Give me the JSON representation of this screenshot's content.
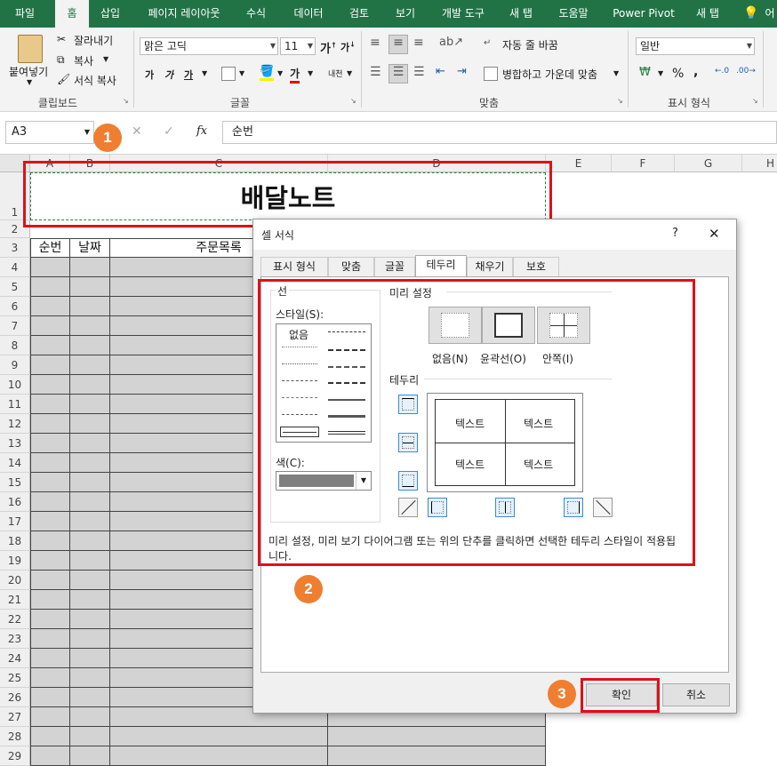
{
  "ribbon_tabs": [
    "파일",
    "홈",
    "삽입",
    "페이지 레이아웃",
    "수식",
    "데이터",
    "검토",
    "보기",
    "개발 도구",
    "새 탭",
    "도움말",
    "Power Pivot",
    "새 탭",
    "어"
  ],
  "clipboard": {
    "paste": "붙여넣기",
    "cut": "잘라내기",
    "copy": "복사",
    "format_painter": "서식 복사",
    "group": "클립보드"
  },
  "font": {
    "name": "맑은 고딕",
    "size": "11",
    "group": "글꼴",
    "bold": "가",
    "italic": "가",
    "underline": "가",
    "grow": "가",
    "shrink": "가",
    "font_color": "가",
    "phonetic": "내천"
  },
  "alignment": {
    "wrap": "자동 줄 바꿈",
    "merge": "병합하고 가운데 맞춤",
    "group": "맞춤"
  },
  "number": {
    "format": "일반",
    "percent": "%",
    "comma": ",",
    "group": "표시 형식"
  },
  "formula_bar": {
    "name_box": "A3",
    "content": "순번",
    "fx": "fx"
  },
  "columns": [
    "A",
    "B",
    "C",
    "D",
    "E",
    "F",
    "G",
    "H"
  ],
  "rows": [
    "1",
    "2",
    "3",
    "4",
    "5",
    "6",
    "7",
    "8",
    "9",
    "10",
    "11",
    "12",
    "13",
    "14",
    "15",
    "16",
    "17",
    "18",
    "19",
    "20",
    "21",
    "22",
    "23",
    "24",
    "25",
    "26",
    "27",
    "28",
    "29"
  ],
  "sheet": {
    "title": "배달노트",
    "headers": [
      "순번",
      "날짜",
      "주문목록"
    ]
  },
  "callouts": [
    "1",
    "2",
    "3"
  ],
  "dialog": {
    "title": "셀 서식",
    "help": "?",
    "close": "✕",
    "tabs": [
      "표시 형식",
      "맞춤",
      "글꼴",
      "테두리",
      "채우기",
      "보호"
    ],
    "active_tab": "테두리",
    "line_group": "선",
    "style_label": "스타일(S):",
    "style_none": "없음",
    "color_label": "색(C):",
    "presets_label": "미리 설정",
    "presets": [
      "없음(N)",
      "윤곽선(O)",
      "안쪽(I)"
    ],
    "border_label": "테두리",
    "preview_text": [
      "텍스트",
      "텍스트",
      "텍스트",
      "텍스트"
    ],
    "hint": "미리 설정, 미리 보기 다이어그램 또는 위의 단추를 클릭하면 선택한 테두리 스타일이 적용됩니다.",
    "ok": "확인",
    "cancel": "취소"
  },
  "colors": {
    "accent": "#217346",
    "callout": "#ef7e30",
    "highlight": "#e0101a"
  }
}
